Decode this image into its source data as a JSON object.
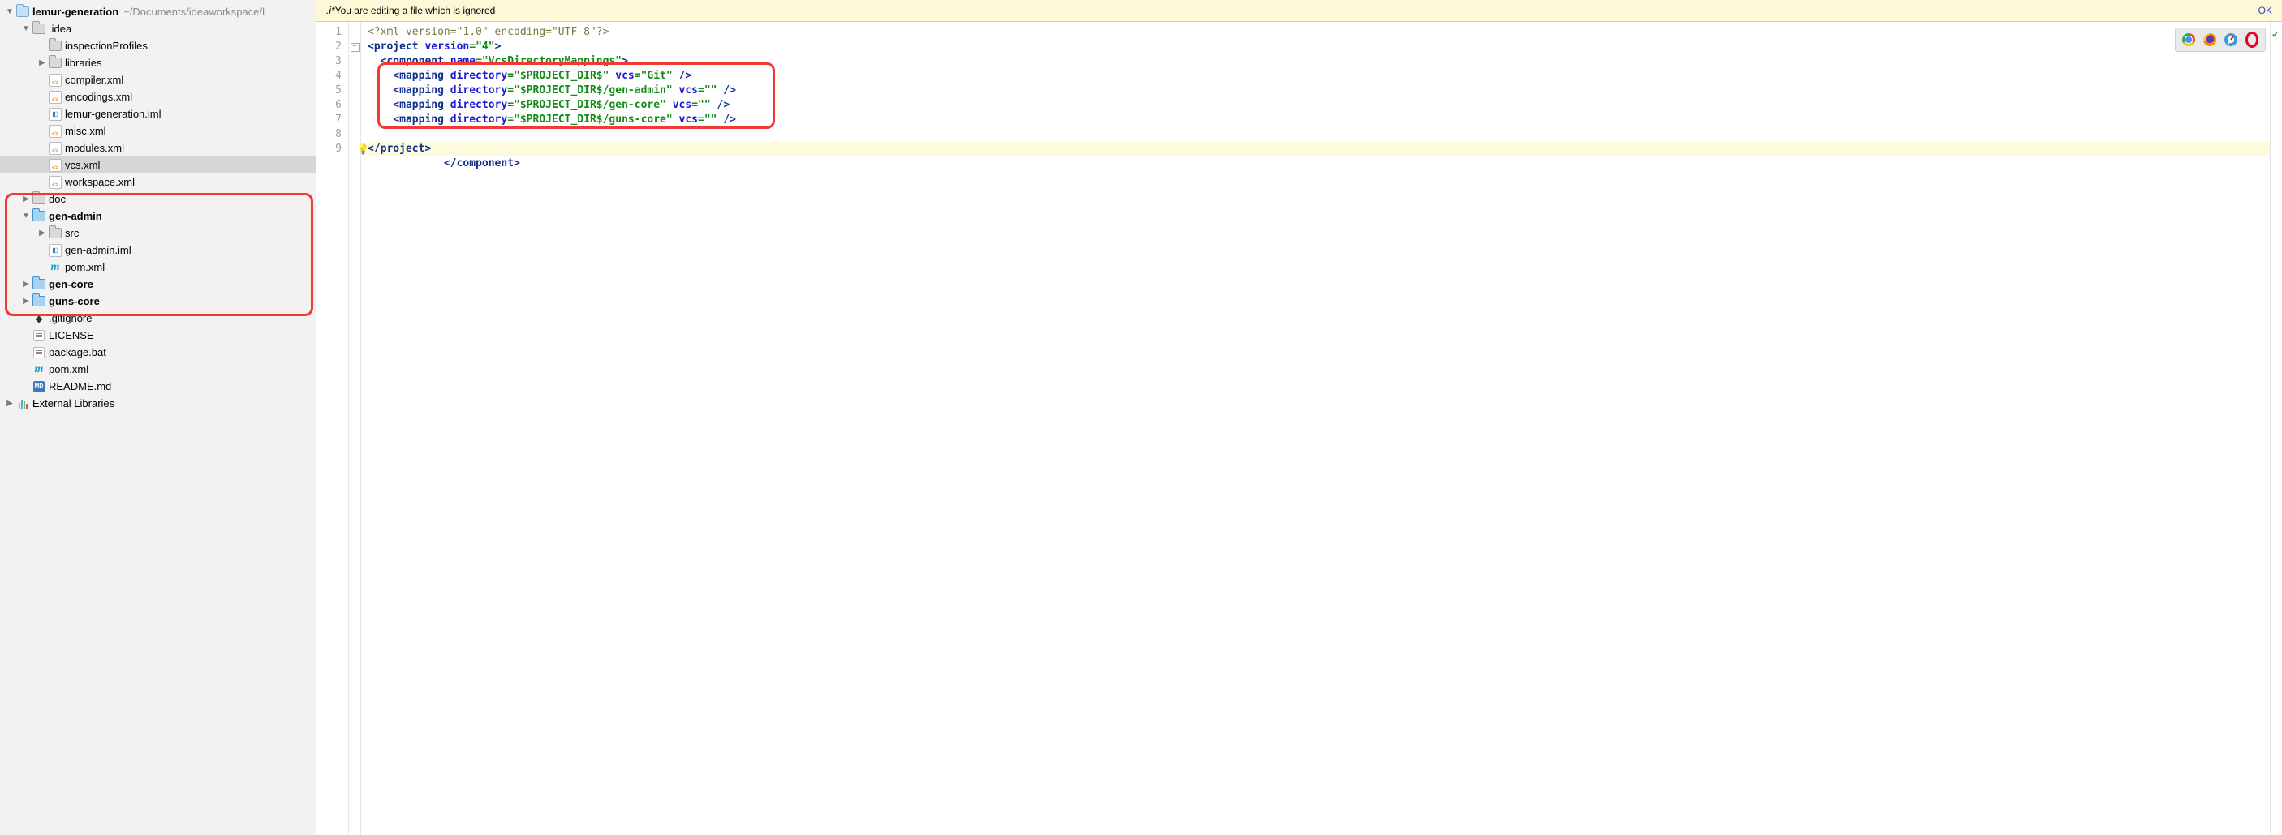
{
  "project": {
    "name": "lemur-generation",
    "path_hint": "~/Documents/ideaworkspace/l"
  },
  "tree": {
    "idea": ".idea",
    "inspectionProfiles": "inspectionProfiles",
    "libraries": "libraries",
    "compiler": "compiler.xml",
    "encodings": "encodings.xml",
    "projIml": "lemur-generation.iml",
    "misc": "misc.xml",
    "modules": "modules.xml",
    "vcs": "vcs.xml",
    "workspace": "workspace.xml",
    "doc": "doc",
    "genAdmin": "gen-admin",
    "src": "src",
    "genAdminIml": "gen-admin.iml",
    "pom": "pom.xml",
    "genCore": "gen-core",
    "gunsCore": "guns-core",
    "gitignore": ".gitignore",
    "license": "LICENSE",
    "packageBat": "package.bat",
    "rootPom": "pom.xml",
    "readme": "README.md",
    "extLib": "External Libraries"
  },
  "banner": {
    "prefix": ".i*",
    "text": " You are editing a file which is ignored",
    "ok": "OK"
  },
  "gutter": [
    "1",
    "2",
    "3",
    "4",
    "5",
    "6",
    "7",
    "8",
    "9"
  ],
  "code": {
    "l1": "<?xml version=\"1.0\" encoding=\"UTF-8\"?>",
    "l2": {
      "a": "<project ",
      "b": "version",
      "c": "=",
      "d": "\"4\"",
      "e": ">"
    },
    "l3": {
      "a": "  <component ",
      "b": "name",
      "c": "=",
      "d": "\"VcsDirectoryMappings\"",
      "e": ">"
    },
    "l4": {
      "a": "    <mapping ",
      "b": "directory",
      "c": "=",
      "d": "\"$PROJECT_DIR$\"",
      "e": " ",
      "f": "vcs",
      "g": "=",
      "h": "\"Git\"",
      "i": " />"
    },
    "l5": {
      "a": "    <mapping ",
      "b": "directory",
      "c": "=",
      "d": "\"$PROJECT_DIR$/gen-admin\"",
      "e": " ",
      "f": "vcs",
      "g": "=",
      "h": "\"\"",
      "i": " />"
    },
    "l6": {
      "a": "    <mapping ",
      "b": "directory",
      "c": "=",
      "d": "\"$PROJECT_DIR$/gen-core\"",
      "e": " ",
      "f": "vcs",
      "g": "=",
      "h": "\"\"",
      "i": " />"
    },
    "l7": {
      "a": "    <mapping ",
      "b": "directory",
      "c": "=",
      "d": "\"$PROJECT_DIR$/guns-core\"",
      "e": " ",
      "f": "vcs",
      "g": "=",
      "h": "\"\"",
      "i": " />"
    },
    "l8": "  </component>",
    "l9": "</project>"
  }
}
